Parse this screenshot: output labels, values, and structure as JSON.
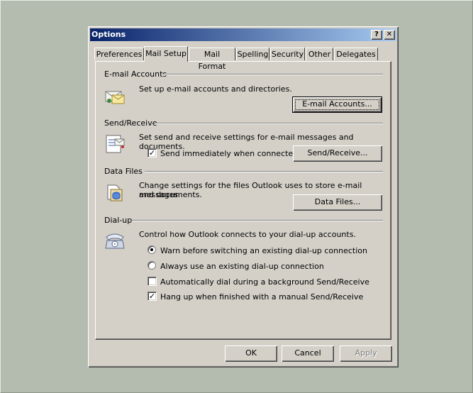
{
  "window": {
    "title": "Options",
    "help_button": "?",
    "close_button": "✕"
  },
  "tabs": [
    {
      "label": "Preferences",
      "active": false
    },
    {
      "label": "Mail Setup",
      "active": true
    },
    {
      "label": "Mail Format",
      "active": false
    },
    {
      "label": "Spelling",
      "active": false
    },
    {
      "label": "Security",
      "active": false
    },
    {
      "label": "Other",
      "active": false
    },
    {
      "label": "Delegates",
      "active": false
    }
  ],
  "email_accounts": {
    "title": "E-mail Accounts",
    "description": "Set up e-mail accounts and directories.",
    "button": "E-mail Accounts...",
    "icon": "email-accounts-icon"
  },
  "send_receive": {
    "title": "Send/Receive",
    "description": "Set send and receive settings for e-mail messages and documents.",
    "checkbox_label": "Send immediately when connected",
    "checkbox_checked": true,
    "button": "Send/Receive...",
    "icon": "send-receive-icon"
  },
  "data_files": {
    "title": "Data Files",
    "description_line1": "Change settings for the files Outlook uses to store e-mail messages",
    "description_line2": "and documents.",
    "button": "Data Files...",
    "icon": "data-files-icon"
  },
  "dialup": {
    "title": "Dial-up",
    "description": "Control how Outlook connects to your dial-up accounts.",
    "radio_warn": "Warn before switching an existing dial-up connection",
    "radio_warn_selected": true,
    "radio_always": "Always use an existing dial-up connection",
    "radio_always_selected": false,
    "check_auto_dial": "Automatically dial during a background Send/Receive",
    "check_auto_dial_checked": false,
    "check_hang_up": "Hang up when finished with a manual Send/Receive",
    "check_hang_up_checked": true,
    "icon": "telephone-icon"
  },
  "footer": {
    "ok": "OK",
    "cancel": "Cancel",
    "apply": "Apply",
    "apply_enabled": false
  },
  "colors": {
    "desktop": "#b3bcaf",
    "dialog_face": "#d4d0c8",
    "title_start": "#0a246a",
    "title_end": "#a6caf0"
  }
}
